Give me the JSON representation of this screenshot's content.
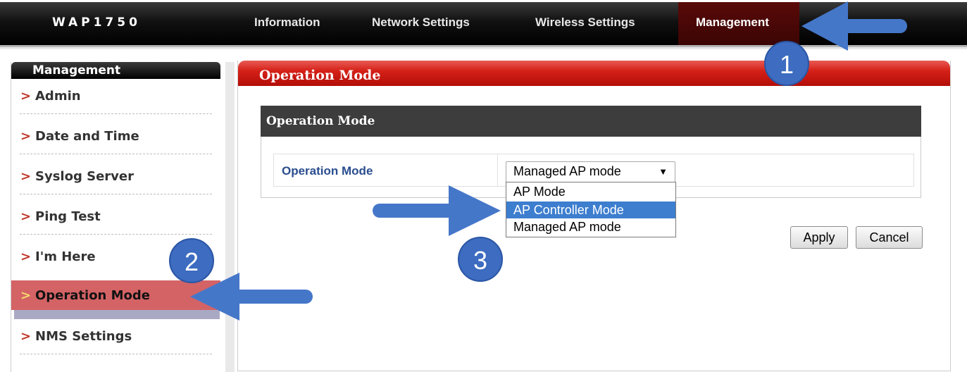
{
  "header": {
    "brand": "WAP1750",
    "tabs": [
      {
        "label": "Information"
      },
      {
        "label": "Network Settings"
      },
      {
        "label": "Wireless Settings"
      },
      {
        "label": "Management"
      }
    ],
    "active_tab": "Management"
  },
  "sidebar": {
    "title": "Management",
    "items": [
      {
        "label": "Admin"
      },
      {
        "label": "Date and Time"
      },
      {
        "label": "Syslog Server"
      },
      {
        "label": "Ping Test"
      },
      {
        "label": "I'm Here"
      },
      {
        "label": "Operation Mode"
      },
      {
        "label": "NMS Settings"
      }
    ],
    "active_item": "Operation Mode",
    "chevron": ">"
  },
  "main": {
    "title": "Operation Mode",
    "section_title": "Operation Mode",
    "field_label": "Operation Mode",
    "select_value": "Managed AP mode",
    "select_arrow": "▼",
    "options": [
      "AP Mode",
      "AP Controller Mode",
      "Managed AP mode"
    ],
    "highlighted_option": "AP Controller Mode",
    "apply_label": "Apply",
    "cancel_label": "Cancel"
  },
  "annotations": {
    "step1": "1",
    "step2": "2",
    "step3": "3"
  },
  "colors": {
    "accent_red": "#d52118",
    "active_sidebar": "#d46366",
    "annotation_blue": "#3d6cc0",
    "option_highlight": "#3d7ecf",
    "label_blue": "#2a4d8e"
  }
}
